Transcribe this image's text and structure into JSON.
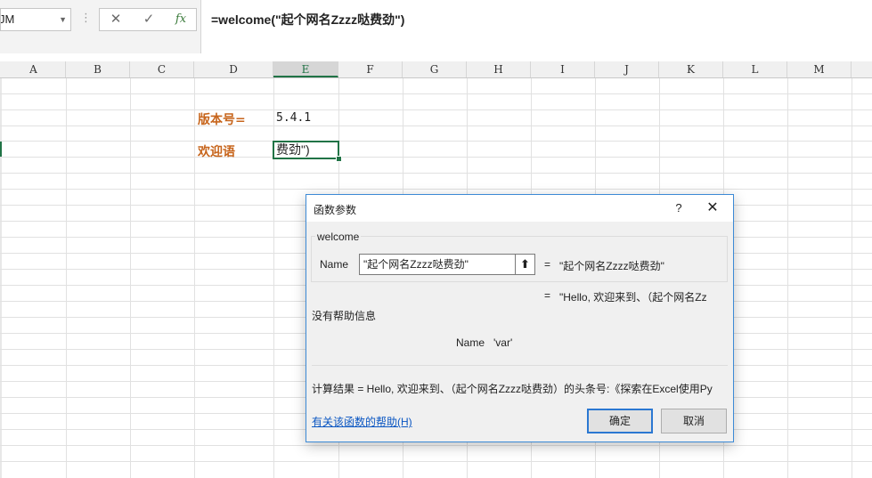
{
  "formula_bar": {
    "name_box": "JM",
    "fx_label": "fx",
    "cancel_glyph": "✕",
    "enter_glyph": "✓",
    "formula": "=welcome(\"起个网名Zzzz哒费劲\")"
  },
  "columns": [
    "A",
    "B",
    "C",
    "D",
    "E",
    "F",
    "G",
    "H",
    "I",
    "J",
    "K",
    "L",
    "M"
  ],
  "selected_column": "E",
  "cells": {
    "d_version_label": "版本号=",
    "e_version_value": "5.4.1",
    "d_greeting_label": "欢迎语",
    "e_greeting_value": "费劲\")"
  },
  "dialog": {
    "title": "函数参数",
    "help_glyph": "?",
    "close_glyph": "✕",
    "function_name": "welcome",
    "arg_label": "Name",
    "arg_value": "\"起个网名Zzzz哒费劲\"",
    "arg_eq": "=",
    "arg_result": "\"起个网名Zzzz哒费劲\"",
    "fn_eq": "=",
    "fn_result": "\"Hello, 欢迎来到、（起个网名Zz",
    "no_help": "没有帮助信息",
    "param_desc": "Name   'var'",
    "calc_result": "计算结果 =   Hello, 欢迎来到、（起个网名Zzzz哒费劲）的头条号:《探索在Excel使用Py",
    "help_link": "有关该函数的帮助(H)",
    "ok_label": "确定",
    "cancel_label": "取消"
  },
  "colors": {
    "accent_green": "#217346",
    "label_orange": "#c7651c",
    "dialog_border": "#3c8ad6",
    "link_blue": "#0a56c2"
  }
}
